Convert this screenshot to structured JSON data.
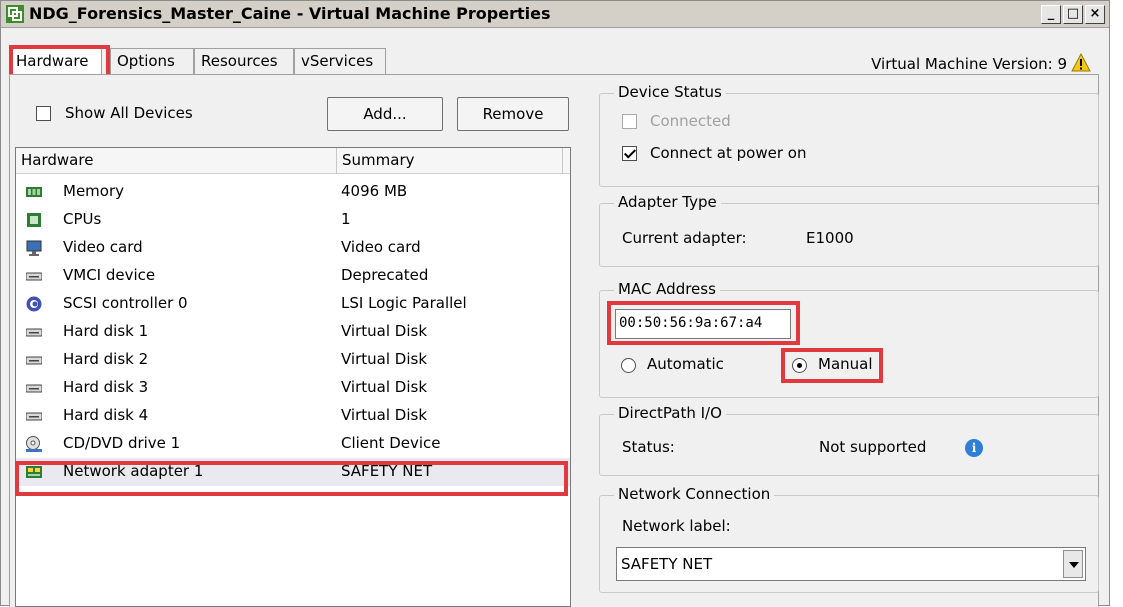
{
  "window": {
    "title": "NDG_Forensics_Master_Caine - Virtual Machine Properties",
    "controls": {
      "minimize": "_",
      "maximize": "□",
      "close": "×"
    }
  },
  "tabs": [
    {
      "label": "Hardware",
      "active": true
    },
    {
      "label": "Options",
      "active": false
    },
    {
      "label": "Resources",
      "active": false
    },
    {
      "label": "vServices",
      "active": false
    }
  ],
  "vm_version": "Virtual Machine Version: 9",
  "hardware_panel": {
    "show_all_devices": {
      "label": "Show All Devices",
      "checked": false
    },
    "add_label": "Add...",
    "remove_label": "Remove",
    "columns": [
      "Hardware",
      "Summary"
    ],
    "devices": [
      {
        "name": "Memory",
        "summary": "4096 MB",
        "icon": "memory-icon"
      },
      {
        "name": "CPUs",
        "summary": "1",
        "icon": "cpu-icon"
      },
      {
        "name": "Video card",
        "summary": "Video card",
        "icon": "monitor-icon"
      },
      {
        "name": "VMCI device",
        "summary": "Deprecated",
        "icon": "device-icon"
      },
      {
        "name": "SCSI controller 0",
        "summary": "LSI Logic Parallel",
        "icon": "scsi-icon"
      },
      {
        "name": "Hard disk 1",
        "summary": "Virtual Disk",
        "icon": "hard-disk-icon"
      },
      {
        "name": "Hard disk 2",
        "summary": "Virtual Disk",
        "icon": "hard-disk-icon"
      },
      {
        "name": "Hard disk 3",
        "summary": "Virtual Disk",
        "icon": "hard-disk-icon"
      },
      {
        "name": "Hard disk 4",
        "summary": "Virtual Disk",
        "icon": "hard-disk-icon"
      },
      {
        "name": "CD/DVD drive 1",
        "summary": "Client Device",
        "icon": "cd-dvd-icon"
      },
      {
        "name": "Network adapter 1",
        "summary": "SAFETY NET",
        "icon": "network-adapter-icon",
        "selected": true
      }
    ]
  },
  "device_status": {
    "title": "Device Status",
    "connected": {
      "label": "Connected",
      "checked": false,
      "enabled": false
    },
    "connect_at_power_on": {
      "label": "Connect at power on",
      "checked": true
    }
  },
  "adapter_type": {
    "title": "Adapter Type",
    "label": "Current adapter:",
    "value": "E1000"
  },
  "mac_address": {
    "title": "MAC Address",
    "value": "00:50:56:9a:67:a4",
    "automatic_label": "Automatic",
    "manual_label": "Manual",
    "selected": "Manual"
  },
  "directpath": {
    "title": "DirectPath I/O",
    "label": "Status:",
    "value": "Not supported"
  },
  "network_connection": {
    "title": "Network Connection",
    "label": "Network label:",
    "value": "SAFETY NET"
  },
  "colors": {
    "highlight": "#e0393e",
    "warning": "#f5c518",
    "info": "#2f7fd8"
  }
}
